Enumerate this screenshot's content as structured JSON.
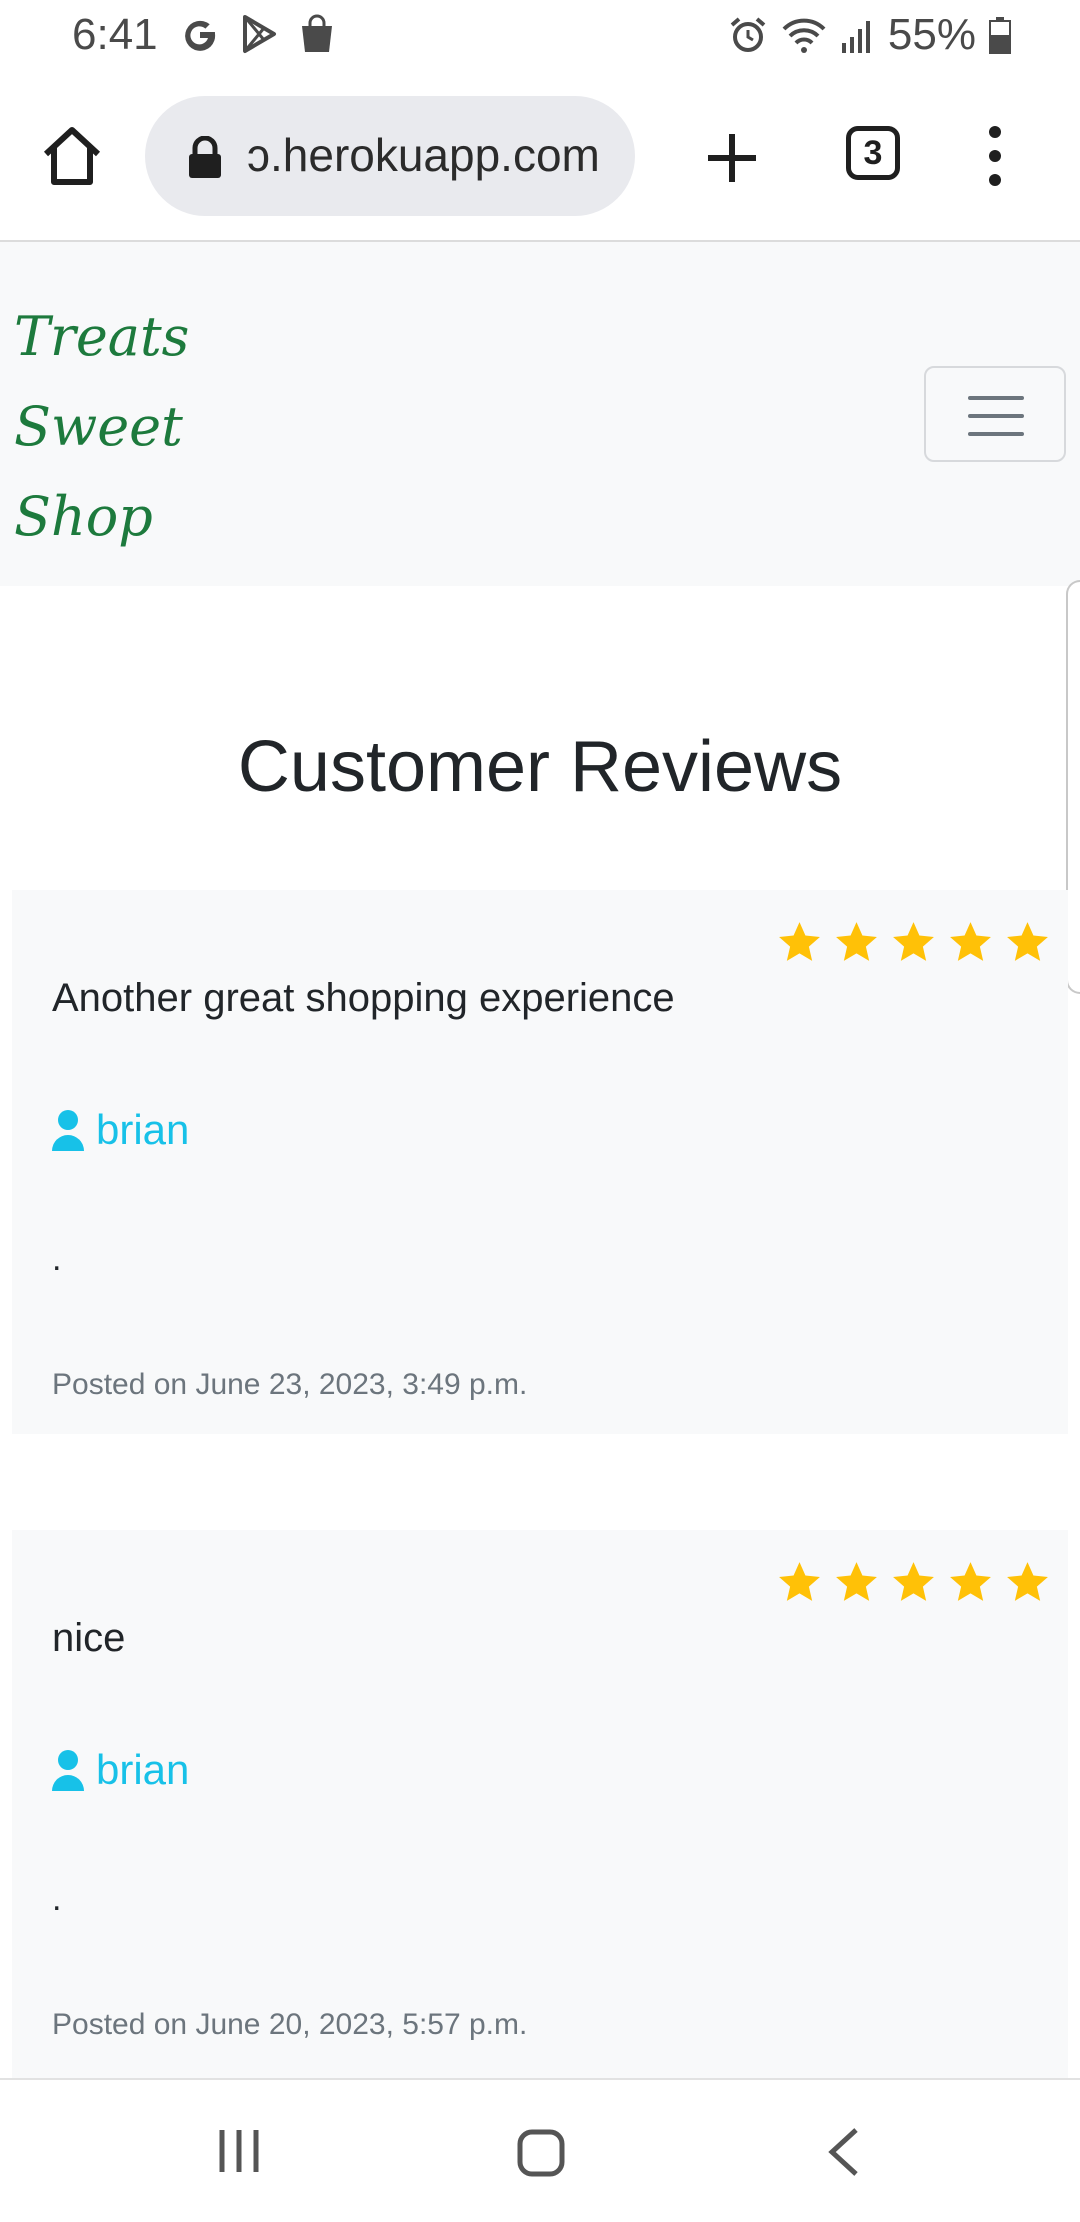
{
  "status_bar": {
    "time": "6:41",
    "battery": "55%",
    "icons": [
      "google-icon",
      "play-store-icon",
      "shopping-bag-icon",
      "alarm-icon",
      "wifi-icon",
      "signal-icon",
      "battery-icon"
    ]
  },
  "browser": {
    "url": "ɔ.herokuapp.com",
    "tab_count": "3"
  },
  "navbar": {
    "brand_line1": "Treats",
    "brand_line2": "Sweet",
    "brand_line3": "Shop",
    "brand_color": "#1d7a3d"
  },
  "page": {
    "title": "Customer Reviews"
  },
  "reviews": [
    {
      "title": "Another great shopping experience",
      "author": "brian",
      "body": ".",
      "date": "Posted on June 23, 2023, 3:49 p.m.",
      "rating": 5
    },
    {
      "title": "nice",
      "author": "brian",
      "body": ".",
      "date": "Posted on June 20, 2023, 5:57 p.m.",
      "rating": 5
    }
  ],
  "colors": {
    "star": "#ffc107",
    "author_link": "#17c1e8",
    "card_bg": "#f8f9fa"
  }
}
